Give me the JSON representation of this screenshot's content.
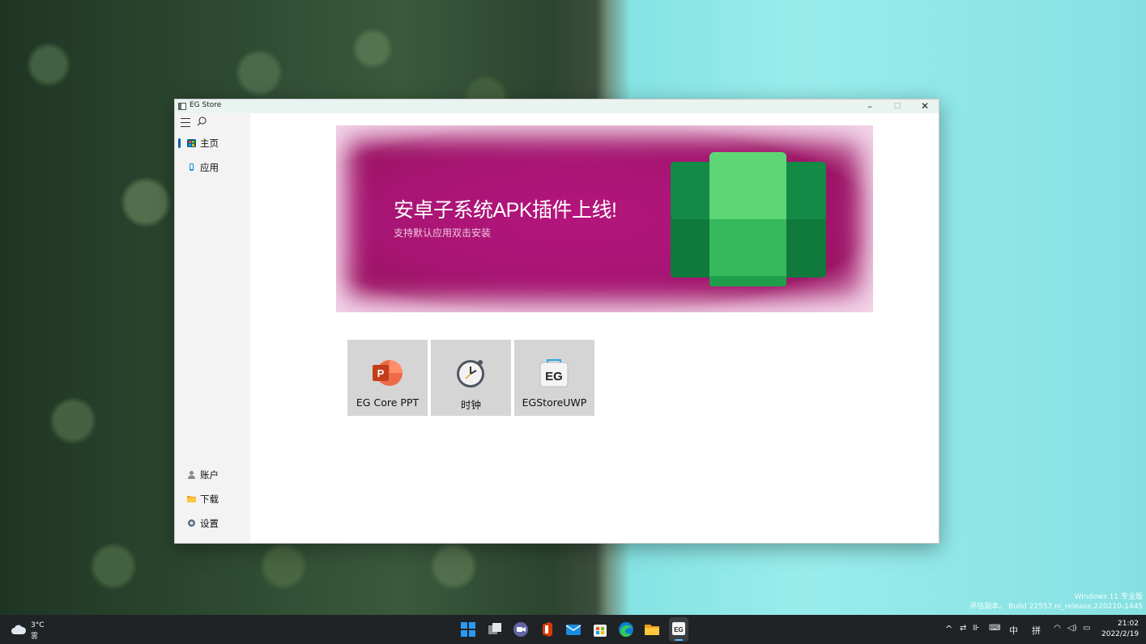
{
  "desktop": {
    "watermark_line1": "Windows 11 专业版",
    "watermark_line2": "评估副本。 Build 22557.ni_release.220210-1445"
  },
  "window": {
    "title": "EG Store",
    "controls": {
      "minimize": "–",
      "maximize": "□",
      "close": "✕"
    }
  },
  "sidebar": {
    "top_items": [
      {
        "label": "主页",
        "icon": "home-store-icon",
        "selected": true
      },
      {
        "label": "应用",
        "icon": "app-icon",
        "selected": false
      }
    ],
    "bottom_items": [
      {
        "label": "账户",
        "icon": "person-icon"
      },
      {
        "label": "下载",
        "icon": "folder-icon"
      },
      {
        "label": "设置",
        "icon": "gear-icon"
      }
    ]
  },
  "banner": {
    "title": "安卓子系统APK插件上线!",
    "subtitle": "支持默认应用双击安装",
    "icon": "android-subsystem-icon"
  },
  "apps": [
    {
      "label": "EG Core PPT",
      "icon": "powerpoint-icon"
    },
    {
      "label": "时钟",
      "icon": "clock-icon"
    },
    {
      "label": "EGStoreUWP",
      "icon": "eg-store-icon"
    }
  ],
  "taskbar": {
    "weather_temp": "3°C",
    "weather_desc": "雾",
    "input_lang": "中",
    "input_mode": "拼",
    "time": "21:02",
    "date": "2022/2/19",
    "pinned": [
      "start-icon",
      "task-view-icon",
      "teams-icon",
      "office-icon",
      "mail-icon",
      "store-icon",
      "edge-icon",
      "explorer-icon",
      "eg-store-icon"
    ]
  },
  "colors": {
    "accent": "#0b5cad",
    "banner": "#a81574",
    "card": "#d5d5d5",
    "taskbar": "#202326"
  }
}
